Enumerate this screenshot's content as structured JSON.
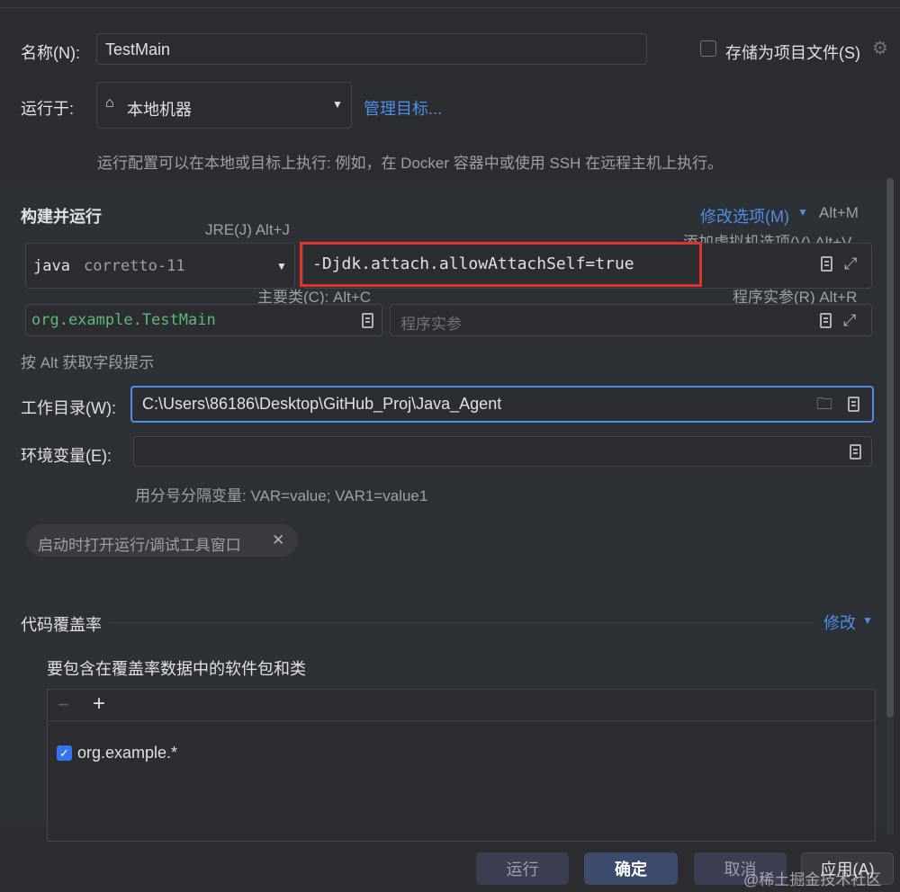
{
  "name_row": {
    "label": "名称(N):",
    "value": "TestMain",
    "store_label": "存储为项目文件(S)"
  },
  "run_on": {
    "label": "运行于:",
    "target": "本地机器",
    "manage_link": "管理目标...",
    "hint": "运行配置可以在本地或目标上执行: 例如，在 Docker 容器中或使用 SSH 在远程主机上执行。"
  },
  "build_run": {
    "title": "构建并运行",
    "modify_options": "修改选项(M)",
    "modify_shortcut": "Alt+M",
    "jre_hint": "JRE(J) Alt+J",
    "vm_hint": "添加虚拟机选项(V) Alt+V",
    "jre_prefix": "java",
    "jre_value": "corretto-11",
    "vm_options": "-Djdk.attach.allowAttachSelf=true",
    "main_class_hint": "主要类(C): Alt+C",
    "program_args_hint": "程序实参(R) Alt+R",
    "main_class": "org.example.TestMain",
    "program_args_placeholder": "程序实参",
    "alt_hint": "按 Alt 获取字段提示"
  },
  "workdir": {
    "label": "工作目录(W):",
    "value": "C:\\Users\\86186\\Desktop\\GitHub_Proj\\Java_Agent"
  },
  "env": {
    "label": "环境变量(E):",
    "value": "",
    "hint": "用分号分隔变量: VAR=value; VAR1=value1"
  },
  "chip": {
    "label": "启动时打开运行/调试工具窗口"
  },
  "coverage": {
    "title": "代码覆盖率",
    "modify_link": "修改",
    "subtitle": "要包含在覆盖率数据中的软件包和类",
    "minus": "−",
    "plus": "+",
    "items": [
      {
        "label": "org.example.*",
        "checked": true
      }
    ]
  },
  "footer": {
    "run": "运行",
    "ok": "确定",
    "cancel": "取消",
    "apply": "应用(A)",
    "watermark": "@稀土掘金技术社区"
  },
  "colors": {
    "accent": "#4e8ee8",
    "highlight_red": "#e3312c",
    "background": "#2b2d30",
    "primary_button": "#3c4a6b"
  }
}
